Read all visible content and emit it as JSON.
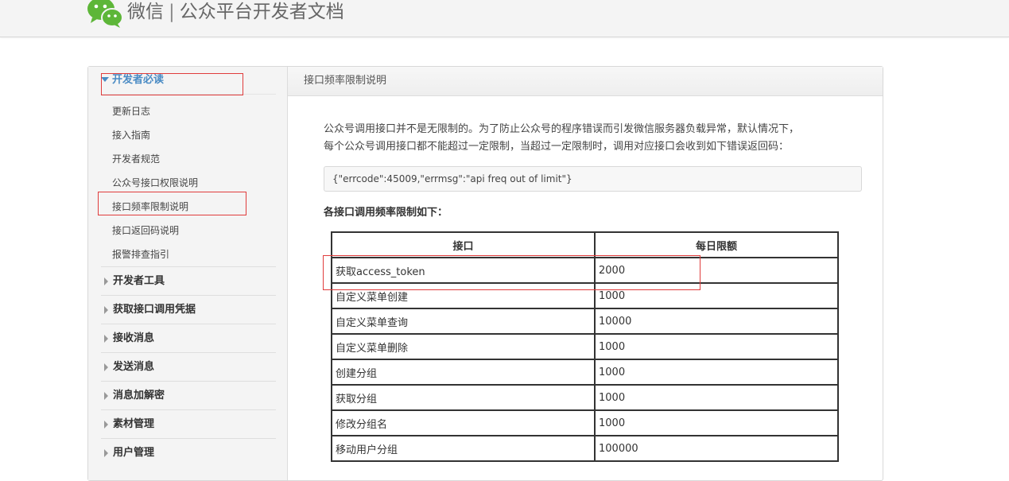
{
  "header": {
    "brand_name": "微信",
    "separator": "|",
    "site_title": "公众平台开发者文档"
  },
  "sidebar": {
    "open_section": {
      "title": "开发者必读",
      "items": [
        "更新日志",
        "接入指南",
        "开发者规范",
        "公众号接口权限说明",
        "接口频率限制说明",
        "接口返回码说明",
        "报警排查指引"
      ]
    },
    "closed_sections": [
      "开发者工具",
      "获取接口调用凭据",
      "接收消息",
      "发送消息",
      "消息加解密",
      "素材管理",
      "用户管理"
    ]
  },
  "content": {
    "title": "接口频率限制说明",
    "intro_line1": "公众号调用接口并不是无限制的。为了防止公众号的程序错误而引发微信服务器负载异常，默认情况下，",
    "intro_line2": "每个公众号调用接口都不能超过一定限制，当超过一定限制时，调用对应接口会收到如下错误返回码：",
    "code_sample": "{\"errcode\":45009,\"errmsg\":\"api freq out of limit\"}",
    "table_title": "各接口调用频率限制如下：",
    "table": {
      "headers": [
        "接口",
        "每日限额"
      ],
      "rows": [
        [
          "获取access_token",
          "2000"
        ],
        [
          "自定义菜单创建",
          "1000"
        ],
        [
          "自定义菜单查询",
          "10000"
        ],
        [
          "自定义菜单删除",
          "1000"
        ],
        [
          "创建分组",
          "1000"
        ],
        [
          "获取分组",
          "1000"
        ],
        [
          "修改分组名",
          "1000"
        ],
        [
          "移动用户分组",
          "100000"
        ]
      ]
    }
  },
  "colors": {
    "link_blue": "#4a8bc4",
    "annotation_red": "#e03c3c",
    "wechat_green": "#5db638"
  }
}
